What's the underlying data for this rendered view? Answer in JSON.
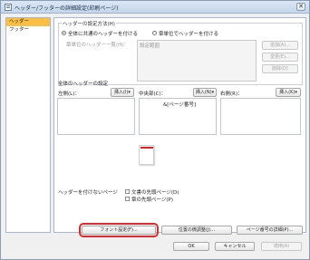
{
  "window": {
    "title": "ヘッダー/フッターの詳細設定(印刷ページ)",
    "close_glyph": "✕"
  },
  "sidebar": {
    "items": [
      {
        "label": "ヘッダー",
        "active": true
      },
      {
        "label": "フッター",
        "active": false
      }
    ]
  },
  "header_method": {
    "legend": "ヘッダーの設定方法(H)",
    "option_all": "全体に共通のヘッダーを付ける",
    "option_page": "章単位でヘッダーを付ける",
    "list_label": "章単位のヘッダー一覧(H)：",
    "list_item": "設定範囲",
    "add_label": "追加(A)...",
    "change_label": "変更(E)...",
    "delete_label": "削除(D)"
  },
  "header_settings": {
    "title": "全体のヘッダーの設定",
    "left_label": "左側(L)：",
    "center_label": "中央部(C)：",
    "right_label": "右側(R)：",
    "insert_i": "挿入(I)▾",
    "insert_n": "挿入(N)▾",
    "insert_k": "挿入(K)▾",
    "center_value": "&[ページ番号]"
  },
  "no_header": {
    "label": "ヘッダーを付けないページ",
    "first_page": "文書の先頭ページ(D)",
    "chapter_first": "章の先頭ページ(P)"
  },
  "buttons": {
    "font": "フォント設定(F)...",
    "position": "位置の微調整(J)...",
    "page_number": "ページ番号の詳細(P)...",
    "ok": "OK",
    "cancel": "キャンセル",
    "apply": "適用(A)"
  }
}
